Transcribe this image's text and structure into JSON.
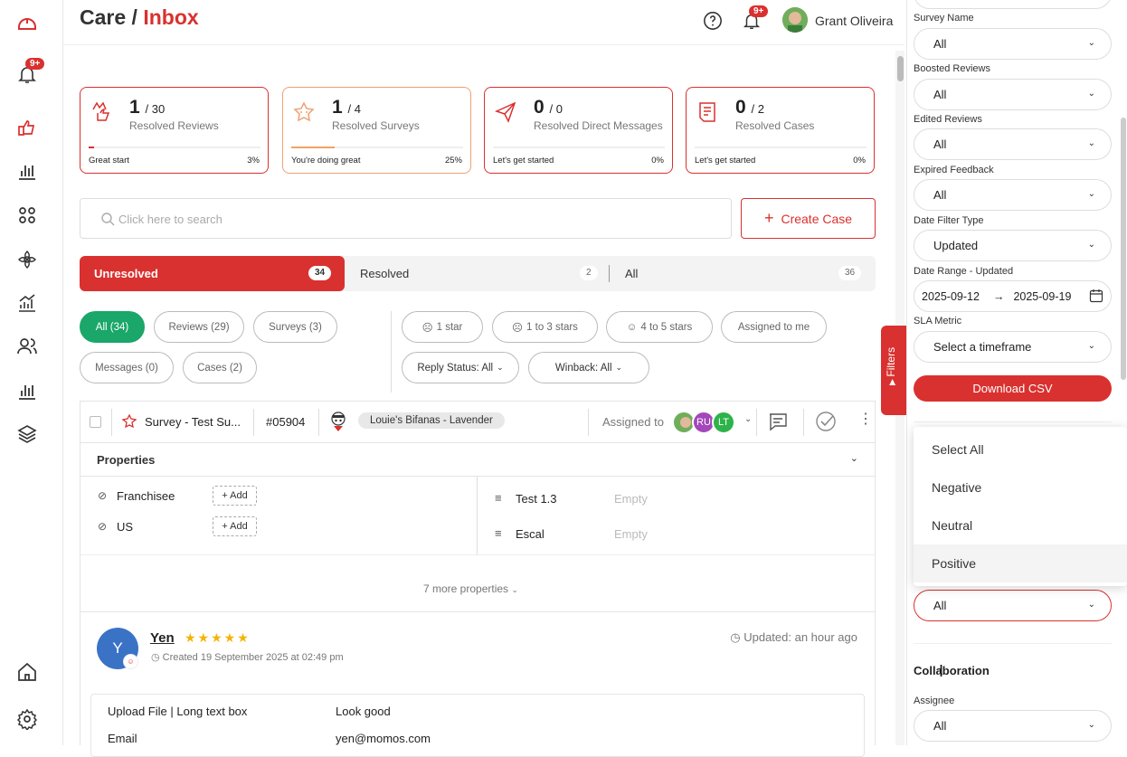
{
  "notif_badge": "9+",
  "header": {
    "title_main": "Care /",
    "title_accent": "Inbox",
    "user_name": "Grant Oliveira",
    "bell_badge": "9+"
  },
  "cards": [
    {
      "num": "1",
      "den": "/ 30",
      "label": "Resolved Reviews",
      "footer": "Great start",
      "pct": "3%",
      "progress": 0.03
    },
    {
      "num": "1",
      "den": "/ 4",
      "label": "Resolved Surveys",
      "footer": "You're doing great",
      "pct": "25%",
      "progress": 0.25
    },
    {
      "num": "0",
      "den": "/ 0",
      "label": "Resolved Direct Messages",
      "footer": "Let's get started",
      "pct": "0%",
      "progress": 0
    },
    {
      "num": "0",
      "den": "/ 2",
      "label": "Resolved Cases",
      "footer": "Let's get started",
      "pct": "0%",
      "progress": 0
    }
  ],
  "search": {
    "placeholder": "Click here to search"
  },
  "create_label": "Create Case",
  "tabs": [
    {
      "label": "Unresolved",
      "count": "34"
    },
    {
      "label": "Resolved",
      "count": "2"
    },
    {
      "label": "All",
      "count": "36"
    }
  ],
  "pills": {
    "all": "All (34)",
    "reviews": "Reviews (29)",
    "surveys": "Surveys (3)",
    "messages": "Messages (0)",
    "cases": "Cases (2)",
    "one_star": "1 star",
    "one_to_three": "1 to 3 stars",
    "four_to_five": "4 to 5 stars",
    "assigned": "Assigned to me",
    "reply_status": "Reply Status: All",
    "winback": "Winback: All"
  },
  "item": {
    "type": "Survey - Test Su...",
    "id": "#05904",
    "location": "Louie's Bifanas - Lavender",
    "assigned_label": "Assigned to",
    "avatars": [
      "RU",
      "LT"
    ]
  },
  "properties": {
    "title": "Properties",
    "left": [
      {
        "name": "Franchisee",
        "add": "+ Add"
      },
      {
        "name": "US",
        "add": "+ Add"
      }
    ],
    "right": [
      {
        "name": "Test 1.3",
        "value": "Empty"
      },
      {
        "name": "Escal",
        "value": "Empty"
      }
    ],
    "more": "7 more properties"
  },
  "review": {
    "initial": "Y",
    "name": "Yen",
    "created": "Created 19 September 2025 at 02:49 pm",
    "updated": "Updated: an hour ago",
    "fields": [
      {
        "key": "Upload File | Long text box",
        "value": "Look good"
      },
      {
        "key": "Email",
        "value": "yen@momos.com"
      }
    ]
  },
  "filter_panel": {
    "tab_label": "Filters",
    "filters": [
      {
        "label": "Survey Name",
        "value": "All"
      },
      {
        "label": "Boosted Reviews",
        "value": "All"
      },
      {
        "label": "Edited Reviews",
        "value": "All"
      },
      {
        "label": "Expired Feedback",
        "value": "All"
      },
      {
        "label": "Date Filter Type",
        "value": "Updated"
      },
      {
        "label": "Date Range - Updated",
        "start": "2025-09-12",
        "end": "2025-09-19"
      },
      {
        "label": "SLA Metric",
        "value": "Select a timeframe"
      }
    ],
    "download": "Download CSV",
    "dropdown_options": [
      "Select All",
      "Negative",
      "Neutral",
      "Positive"
    ],
    "sentiment_value": "All",
    "section": "Collaboration",
    "assignee_label": "Assignee",
    "assignee_value": "All"
  },
  "colors": {
    "brand_red": "#d9312f",
    "green": "#1aa769",
    "orange": "#f5a061"
  }
}
